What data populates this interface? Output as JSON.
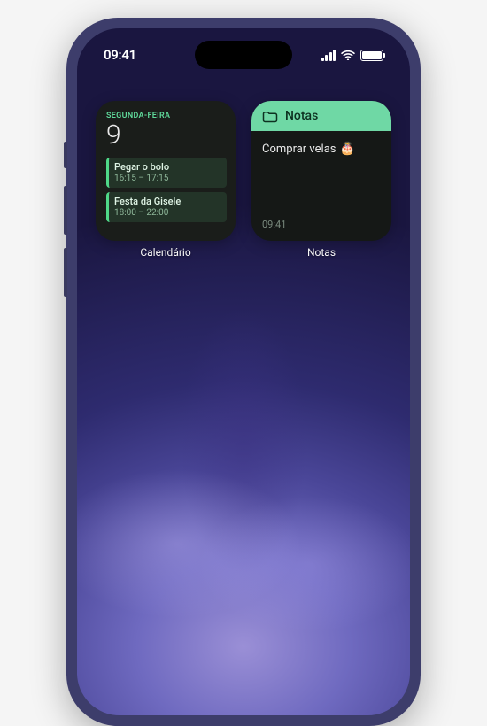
{
  "status": {
    "time": "09:41"
  },
  "calendar": {
    "day_label": "SEGUNDA-FEIRA",
    "date": "9",
    "events": [
      {
        "title": "Pegar o bolo",
        "time": "16:15 – 17:15"
      },
      {
        "title": "Festa da Gisele",
        "time": "18:00 – 22:00"
      }
    ],
    "widget_label": "Calendário"
  },
  "notes": {
    "header_title": "Notas",
    "content": "Comprar velas",
    "emoji": "🎂",
    "timestamp": "09:41",
    "widget_label": "Notas"
  }
}
